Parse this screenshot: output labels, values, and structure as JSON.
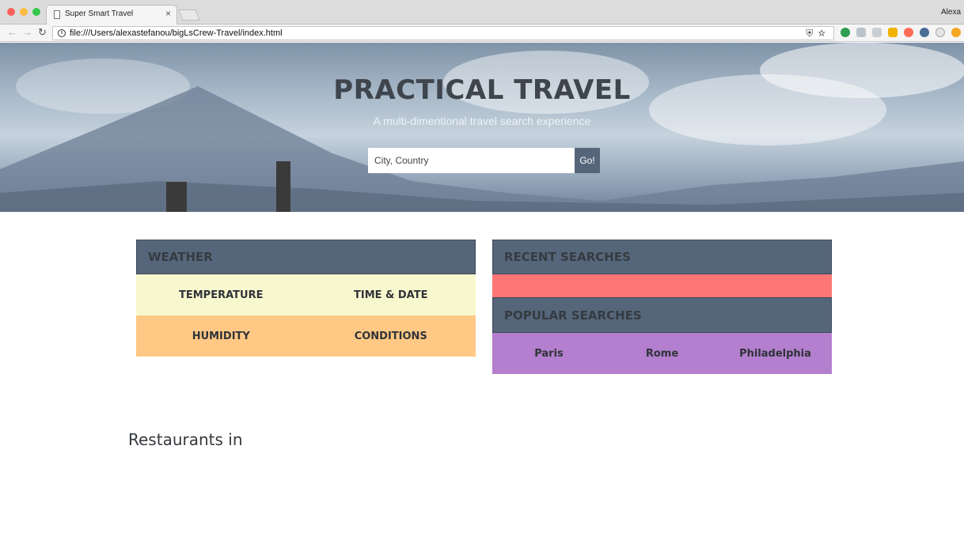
{
  "browser": {
    "tab_title": "Super Smart Travel",
    "tab_close": "×",
    "profile_name": "Alexa",
    "url": "file:///Users/alexastefanou/bigLsCrew-Travel/index.html",
    "nav_back": "←",
    "nav_forward": "→",
    "nav_reload": "↻",
    "omni_icons": "⛨☆"
  },
  "hero": {
    "title": "PRACTICAL TRAVEL",
    "subtitle": "A multi-dimentional travel search experience",
    "search_placeholder": "City, Country",
    "go_label": "Go!"
  },
  "weather": {
    "heading": "WEATHER",
    "row1": [
      "TEMPERATURE",
      "TIME & DATE"
    ],
    "row2": [
      "HUMIDITY",
      "CONDITIONS"
    ]
  },
  "searches": {
    "recent_heading": "RECENT SEARCHES",
    "popular_heading": "POPULAR SEARCHES",
    "popular": [
      "Paris",
      "Rome",
      "Philadelphia"
    ]
  },
  "restaurants": {
    "heading": "Restaurants in"
  },
  "colors": {
    "panel_header": "#56667a",
    "weather_row1": "#f8f8cf",
    "weather_row2": "#ffc985",
    "recent_body": "#ff7676",
    "popular_body": "#b37fce"
  }
}
